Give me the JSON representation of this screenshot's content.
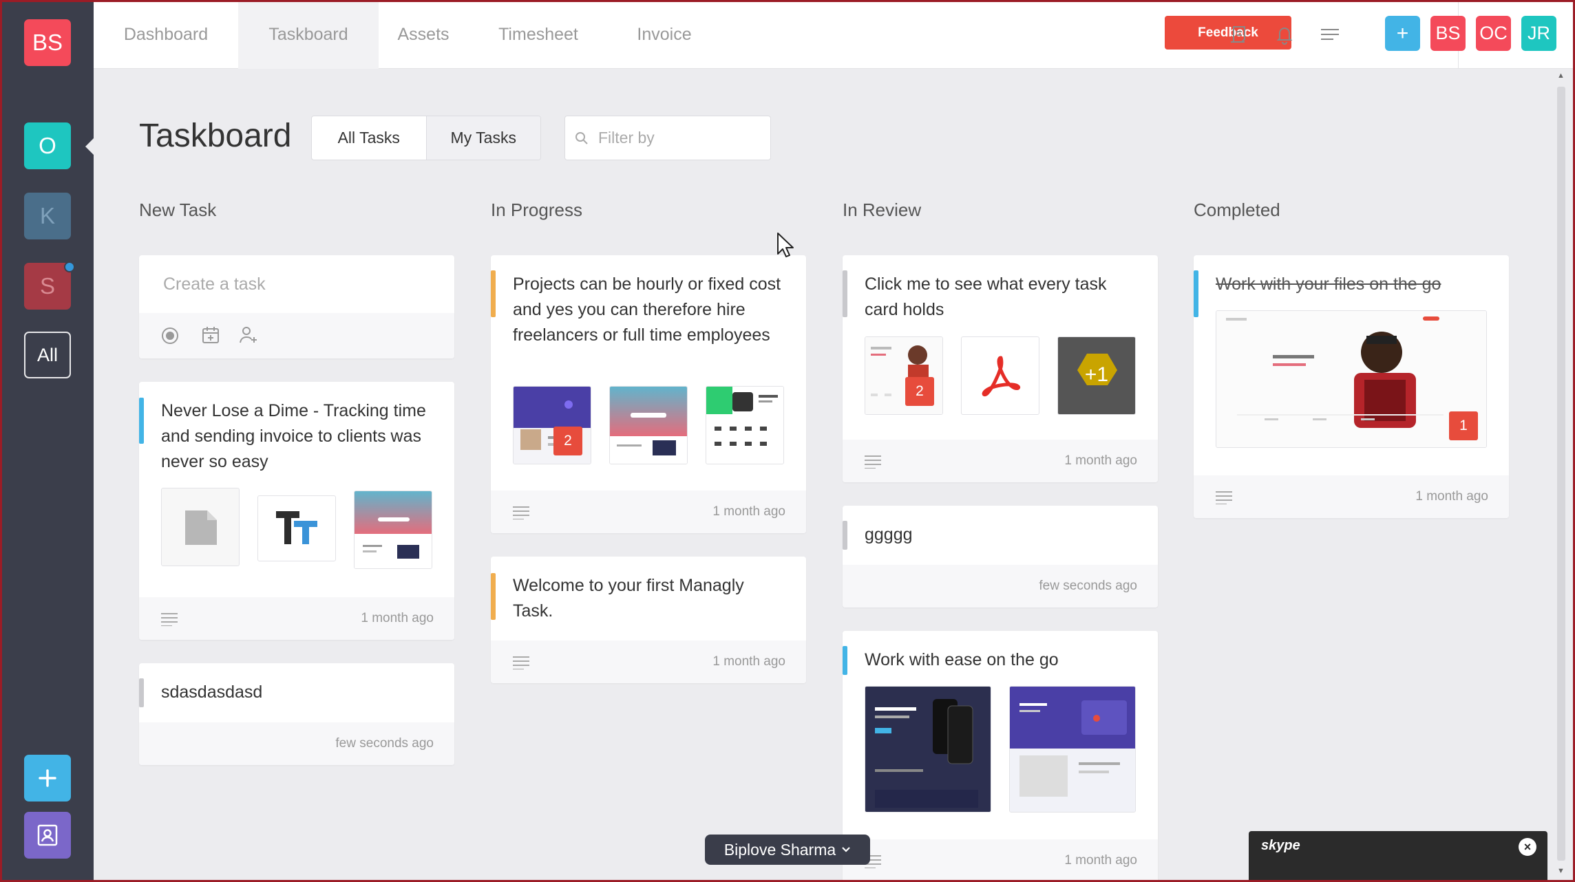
{
  "sidebar": {
    "workspaces": [
      {
        "label": "BS",
        "color": "#f44a5a"
      },
      {
        "label": "O",
        "color": "#1ec6c0"
      },
      {
        "label": "K",
        "color": "#4a6e8a"
      },
      {
        "label": "S",
        "color": "#a53a45"
      },
      {
        "label": "All",
        "color": "#3b3e4b"
      }
    ],
    "add_icon": "plus-icon",
    "contacts_icon": "contact-card-icon"
  },
  "nav": {
    "tabs": [
      "Dashboard",
      "Taskboard",
      "Assets",
      "Timesheet",
      "Invoice"
    ],
    "active": "Taskboard",
    "feedback_label": "Feedback",
    "icons": [
      "notes-icon",
      "bell-icon",
      "menu-lines-icon"
    ],
    "add_label": "+",
    "avatars": [
      {
        "label": "BS",
        "color": "#f44a5a"
      },
      {
        "label": "OC",
        "color": "#f44a5a"
      },
      {
        "label": "JR",
        "color": "#1ec6c0"
      }
    ]
  },
  "page": {
    "title": "Taskboard",
    "filter_all": "All Tasks",
    "filter_mine": "My Tasks",
    "filter_placeholder": "Filter by"
  },
  "columns": {
    "new": {
      "title": "New Task",
      "create_placeholder": "Create a task",
      "cards": [
        {
          "title": "Never Lose a Dime - Tracking time and sending invoice to clients was never so easy",
          "time": "1 month ago"
        },
        {
          "title": "sdasdasdasd",
          "time": "few seconds ago"
        }
      ]
    },
    "progress": {
      "title": "In Progress",
      "cards": [
        {
          "title": "Projects can be hourly or fixed cost and yes you can therefore hire freelancers or full time employees",
          "time": "1 month ago",
          "badge": "2"
        },
        {
          "title": "Welcome to your first Managly Task.",
          "time": "1 month ago"
        }
      ]
    },
    "review": {
      "title": "In Review",
      "cards": [
        {
          "title": "Click me to see what every task card holds",
          "time": "1 month ago",
          "badge": "2",
          "more": "+1"
        },
        {
          "title": "ggggg",
          "time": "few seconds ago"
        },
        {
          "title": "Work with ease on the go",
          "time": "1 month ago"
        }
      ]
    },
    "completed": {
      "title": "Completed",
      "cards": [
        {
          "title": "Work with your files on the go",
          "time": "1 month ago",
          "badge": "1"
        }
      ]
    }
  },
  "footer": {
    "user_name": "Biplove Sharma",
    "skype_label": "skype"
  },
  "colors": {
    "accent_blue": "#42b4e6",
    "accent_orange": "#f0ad4e",
    "accent_grey": "#c8c8cc",
    "accent_red": "#ec4a3c"
  }
}
